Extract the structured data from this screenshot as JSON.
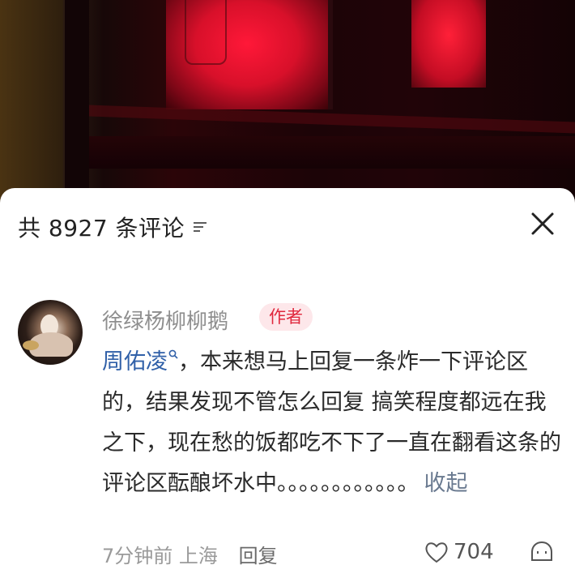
{
  "header": {
    "comment_count_label": "共 8927 条评论"
  },
  "comment": {
    "username": "徐绿杨柳柳鹅",
    "badge": "作者",
    "mention": "周佑凌",
    "text": "，本来想马上回复一条炸一下评论区的，结果发现不管怎么回复 搞笑程度都远在我之下，现在愁的饭都吃不下了一直在翻看这条的评论区酝酿坏水中。。。。。。。。。。。。",
    "collapse_label": "收起",
    "time": "7分钟前",
    "location": "上海",
    "reply_label": "回复",
    "like_count": "704"
  },
  "icons": {
    "sort": "sort-lines-icon",
    "close": "close-icon",
    "mention_search": "search-icon",
    "like": "heart-icon",
    "dislike": "dislike-icon"
  },
  "colors": {
    "badge_bg": "#fde7ea",
    "badge_text": "#e0283d",
    "mention": "#3060a8"
  }
}
